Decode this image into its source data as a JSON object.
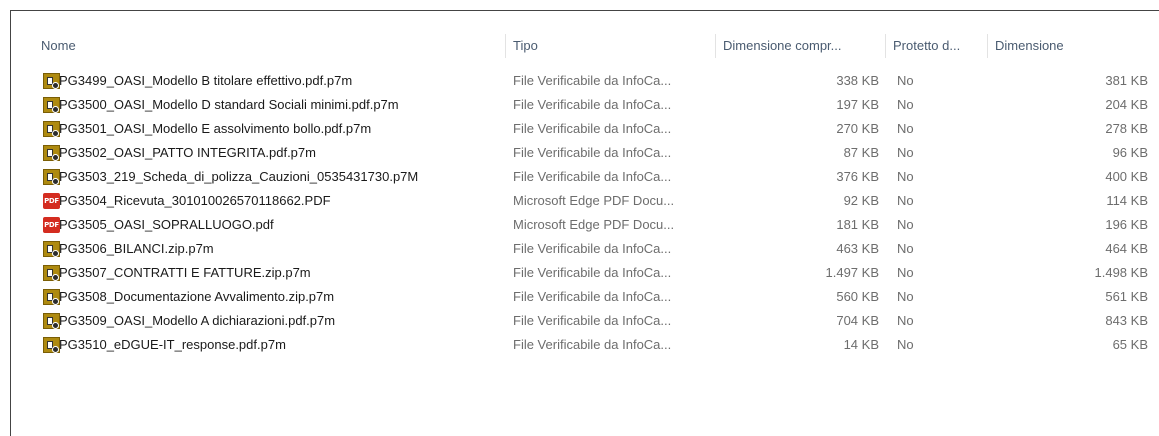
{
  "columns": {
    "name": "Nome",
    "type": "Tipo",
    "compressed_size": "Dimensione compr...",
    "protected": "Protetto d...",
    "size": "Dimensione"
  },
  "files": [
    {
      "name": "PG3499_OASI_Modello B titolare effettivo.pdf.p7m",
      "type": "File Verificabile da InfoCa...",
      "compressed_size": "338 KB",
      "protected": "No",
      "size": "381 KB",
      "icon": "p7m-file-icon"
    },
    {
      "name": "PG3500_OASI_Modello D standard Sociali minimi.pdf.p7m",
      "type": "File Verificabile da InfoCa...",
      "compressed_size": "197 KB",
      "protected": "No",
      "size": "204 KB",
      "icon": "p7m-file-icon"
    },
    {
      "name": "PG3501_OASI_Modello E assolvimento bollo.pdf.p7m",
      "type": "File Verificabile da InfoCa...",
      "compressed_size": "270 KB",
      "protected": "No",
      "size": "278 KB",
      "icon": "p7m-file-icon"
    },
    {
      "name": "PG3502_OASI_PATTO INTEGRITA.pdf.p7m",
      "type": "File Verificabile da InfoCa...",
      "compressed_size": "87 KB",
      "protected": "No",
      "size": "96 KB",
      "icon": "p7m-file-icon"
    },
    {
      "name": "PG3503_219_Scheda_di_polizza_Cauzioni_0535431730.p7M",
      "type": "File Verificabile da InfoCa...",
      "compressed_size": "376 KB",
      "protected": "No",
      "size": "400 KB",
      "icon": "p7m-file-icon"
    },
    {
      "name": "PG3504_Ricevuta_301010026570118662.PDF",
      "type": "Microsoft Edge PDF Docu...",
      "compressed_size": "92 KB",
      "protected": "No",
      "size": "114 KB",
      "icon": "pdf-file-icon"
    },
    {
      "name": "PG3505_OASI_SOPRALLUOGO.pdf",
      "type": "Microsoft Edge PDF Docu...",
      "compressed_size": "181 KB",
      "protected": "No",
      "size": "196 KB",
      "icon": "pdf-file-icon"
    },
    {
      "name": "PG3506_BILANCI.zip.p7m",
      "type": "File Verificabile da InfoCa...",
      "compressed_size": "463 KB",
      "protected": "No",
      "size": "464 KB",
      "icon": "p7m-file-icon"
    },
    {
      "name": "PG3507_CONTRATTI E FATTURE.zip.p7m",
      "type": "File Verificabile da InfoCa...",
      "compressed_size": "1.497 KB",
      "protected": "No",
      "size": "1.498 KB",
      "icon": "p7m-file-icon"
    },
    {
      "name": "PG3508_Documentazione Avvalimento.zip.p7m",
      "type": "File Verificabile da InfoCa...",
      "compressed_size": "560 KB",
      "protected": "No",
      "size": "561 KB",
      "icon": "p7m-file-icon"
    },
    {
      "name": "PG3509_OASI_Modello A dichiarazioni.pdf.p7m",
      "type": "File Verificabile da InfoCa...",
      "compressed_size": "704 KB",
      "protected": "No",
      "size": "843 KB",
      "icon": "p7m-file-icon"
    },
    {
      "name": "PG3510_eDGUE-IT_response.pdf.p7m",
      "type": "File Verificabile da InfoCa...",
      "compressed_size": "14 KB",
      "protected": "No",
      "size": "65 KB",
      "icon": "p7m-file-icon"
    }
  ],
  "pdf_icon_label": "PDF"
}
